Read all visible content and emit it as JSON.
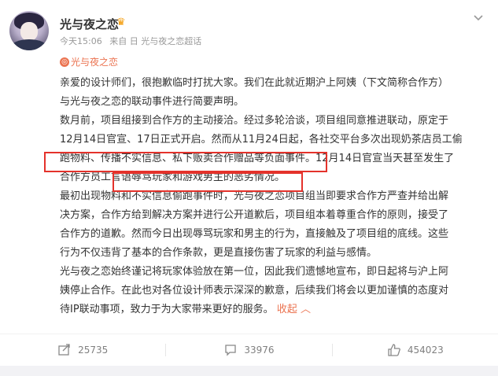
{
  "post": {
    "username": "光与夜之恋",
    "badge_icon": "crown-badge-icon",
    "time": "今天15:06",
    "source": "来自 日 光与夜之恋超话",
    "topic": "光与夜之恋",
    "paragraphs": [
      "亲爱的设计师们，很抱歉临时打扰大家。我们在此就近期沪上阿姨（下文简称合作方）",
      "与光与夜之恋的联动事件进行简要声明。",
      "数月前，项目组接到合作方的主动接洽。经过多轮洽谈，项目组同意推进联动，原定于",
      "12月14日官宣、17日正式开启。然而从11月24日起，各社交平台多次出现奶茶店员工偷",
      "跑物料、传播不实信息、私下贩卖合作赠品等负面事件。12月14日官宣当天甚至发生了",
      "合作方员工言语辱骂玩家和游戏男主的恶劣情况。",
      "最初出现物料和不实信息偷跑事件时，光与夜之恋项目组当即要求合作方严查并给出解",
      "决方案，合作方给到解决方案并进行公开道歉后，项目组本着尊重合作的原则，接受了",
      "合作方的道歉。然而今日出现辱骂玩家和男主的行为，直接触及了项目组的底线。这些",
      "行为不仅违背了基本的合作条款，更是直接伤害了玩家的利益与感情。",
      "光与夜之恋始终谨记将玩家体验放在第一位，因此我们遗憾地宣布，即日起将与沪上阿",
      "姨停止合作。在此也对各位设计师表示深深的歉意，后续我们将会以更加谨慎的态度对"
    ],
    "last_line": "待IP联动事项，致力于为大家带来更好的服务。",
    "collapse_label": "收起",
    "collapse_icon": "chevron-up-icon"
  },
  "actions": {
    "repost_count": "25735",
    "comment_count": "33976",
    "like_count": "454023"
  },
  "colors": {
    "accent": "#eb7350",
    "highlight_box": "#e4322b",
    "text": "#333333",
    "meta": "#999999"
  }
}
